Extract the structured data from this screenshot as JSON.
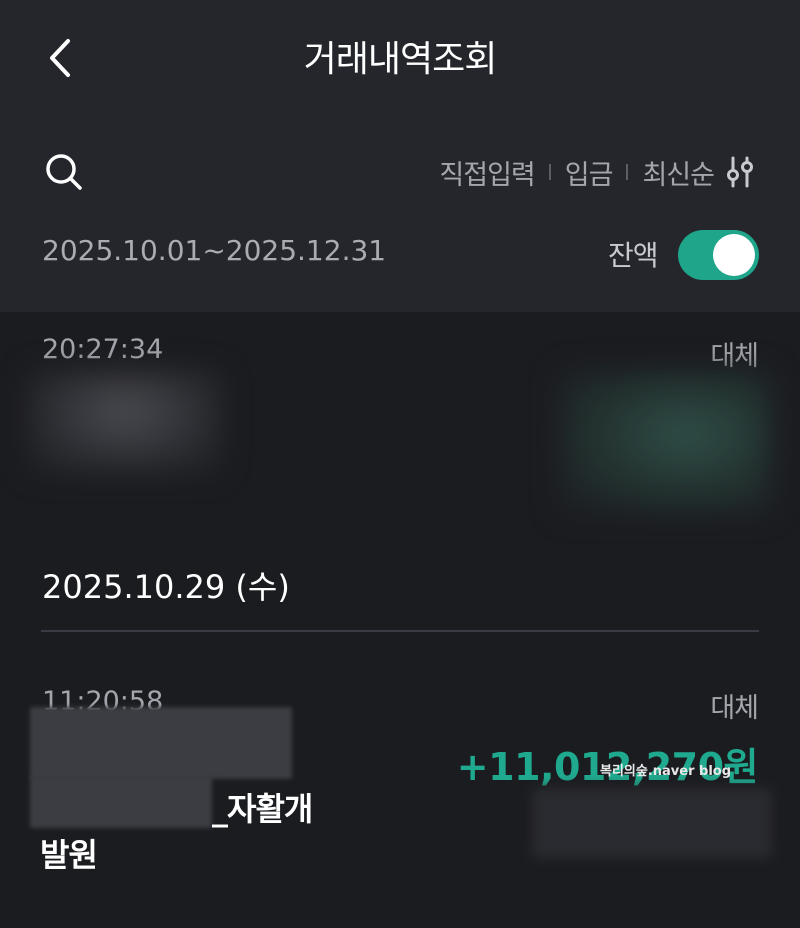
{
  "header": {
    "title": "거래내역조회",
    "back_icon": "chevron-left-icon"
  },
  "toolbar": {
    "search_icon": "search-icon",
    "filters": [
      "직접입력",
      "입금",
      "최신순"
    ],
    "sort_icon": "sliders-icon"
  },
  "period": {
    "range": "2025.10.01~2025.12.31",
    "balance_label": "잔액",
    "balance_toggle_on": true,
    "toggle_color": "#1ea58a"
  },
  "transactions": [
    {
      "time": "20:27:34",
      "kind": "대체"
    },
    {
      "date": "2025.10.29 (수)",
      "time": "11:20:58",
      "kind": "대체",
      "desc_line1": "_자활개",
      "desc_line2": "발원",
      "amount": "+11,012,270원"
    }
  ],
  "watermark": "복리의숲.naver blog",
  "colors": {
    "accent": "#1fa98e",
    "background": "#1b1c20",
    "header_bg": "#24262c"
  }
}
